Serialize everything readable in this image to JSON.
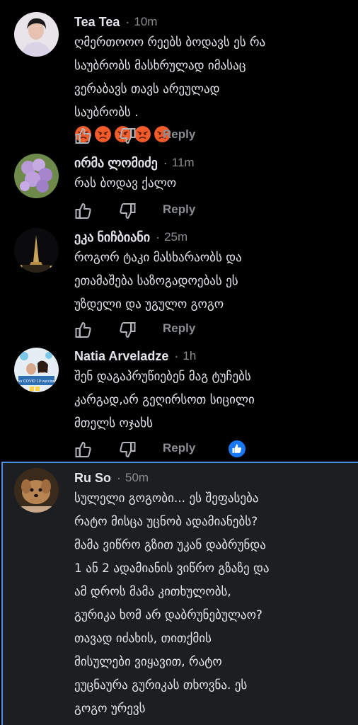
{
  "comments": [
    {
      "author": "Tea Tea",
      "time": "10m",
      "text": "ღმერთოოო რეებს ბოდავს ეს რა\nსაუბრობს მასხრულად იმასაც\nვერაბავს თავს არეულად\nსაუბრობს .",
      "emojis": [
        "angry-face-emoji",
        "angry-face-emoji",
        "angry-face-emoji",
        "angry-face-emoji",
        "angry-face-emoji"
      ],
      "reply": "Reply"
    },
    {
      "author": "ირმა ლომიძე",
      "time": "11m",
      "text": "რას ბოდავ ქალო",
      "reply": "Reply"
    },
    {
      "author": "ეკა ნიჩბიანი",
      "time": "25m",
      "text": "როგორ ტაკი მასხარაობს და\nეთამაშება საზოგადოებას ეს\nუზდელი და უგულო გოგო",
      "reply": "Reply"
    },
    {
      "author": "Natia Arveladze",
      "time": "1h",
      "text": "შენ დაგაპრუწიებენ მაგ ტუჩებს\nკარგად,არ გეღირსოთ სიცილი\nმთელს ოჯახს",
      "reply": "Reply",
      "avatar_caption": "no COVID 19 vaccine"
    },
    {
      "author": "Ru So",
      "time": "50m",
      "text": "სულელი გოგობი... ეს შეფასება\nრატო მისცა უცნობ ადამიანებს?\nმამა ვიწრო გზით უკან დაბრუნდა\n1 ან 2 ადამიანის ვიწრო გზაზე და\nამ დროს მამა კითხულობს,\nგურიკა ხომ არ დაბრუნებულაო?\nთავად იძახის, თითქმის\nმისულები ვიყავით, რატო\nეუცნაურა გურიკას თხოვნა. ეს\nგოგო ურევს"
    }
  ],
  "colors": {
    "background": "#000000",
    "highlight_bg": "#1c1e21",
    "highlight_border": "#4a90e2",
    "text": "#e4e6eb",
    "secondary": "#8a8d91",
    "like_blue": "#1877f2"
  }
}
